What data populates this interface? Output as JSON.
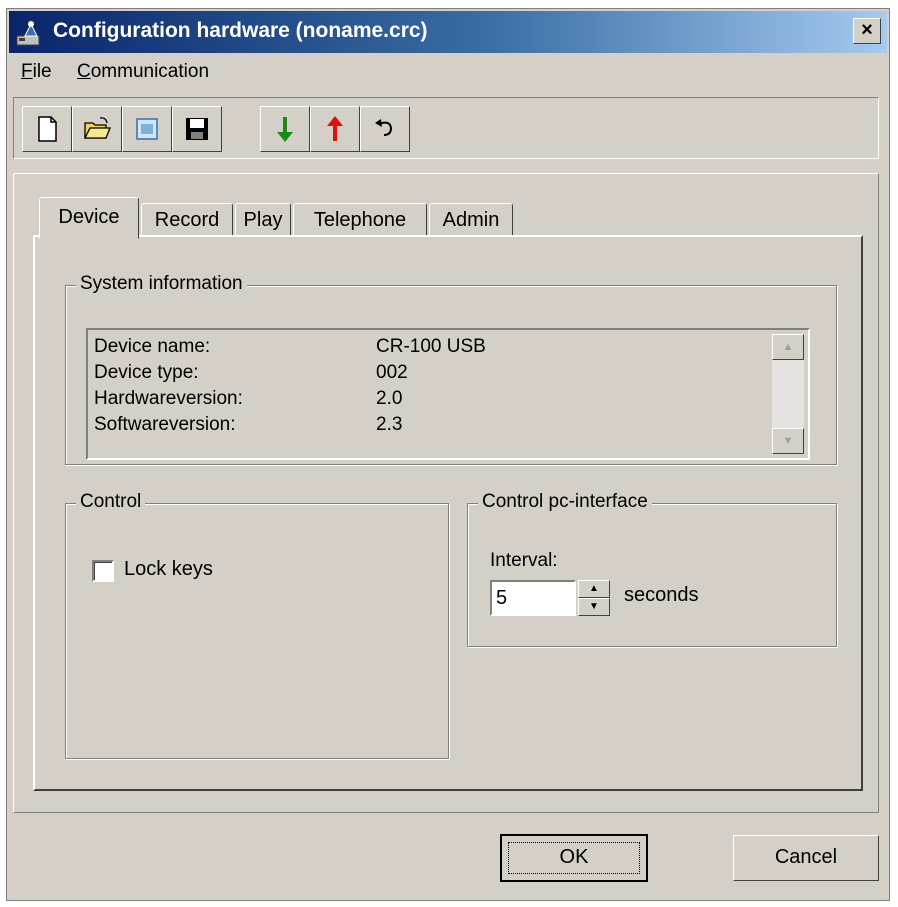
{
  "window": {
    "title": "Configuration hardware (noname.crc)",
    "close_label": "×"
  },
  "menu": {
    "items": [
      "File",
      "Communication"
    ]
  },
  "toolbar": {
    "buttons": [
      {
        "icon": "new-file-icon"
      },
      {
        "icon": "open-folder-icon"
      },
      {
        "icon": "properties-icon"
      },
      {
        "icon": "save-icon"
      },
      {
        "icon": "download-arrow-icon",
        "color": "#1a8a1a"
      },
      {
        "icon": "upload-arrow-icon",
        "color": "#e01010"
      },
      {
        "icon": "undo-icon"
      }
    ]
  },
  "tabs": [
    {
      "label": "Device",
      "active": true
    },
    {
      "label": "Record",
      "active": false
    },
    {
      "label": "Play",
      "active": false
    },
    {
      "label": "Telephone",
      "active": false
    },
    {
      "label": "Admin",
      "active": false
    }
  ],
  "system_info": {
    "group_label": "System information",
    "rows": [
      {
        "label": "Device name:",
        "value": "CR-100 USB"
      },
      {
        "label": "Device type:",
        "value": "002"
      },
      {
        "label": "Hardwareversion:",
        "value": "2.0"
      },
      {
        "label": "Softwareversion:",
        "value": "2.3"
      }
    ]
  },
  "control": {
    "group_label": "Control",
    "lock_keys_label": "Lock keys",
    "lock_keys_checked": false
  },
  "pc_interface": {
    "group_label": "Control pc-interface",
    "interval_label": "Interval:",
    "interval_value": "5",
    "unit_label": "seconds"
  },
  "buttons": {
    "ok": "OK",
    "cancel": "Cancel"
  },
  "colors": {
    "titlebar_start": "#0a246a",
    "titlebar_end": "#a6caf0",
    "face": "#d4d0c8"
  }
}
